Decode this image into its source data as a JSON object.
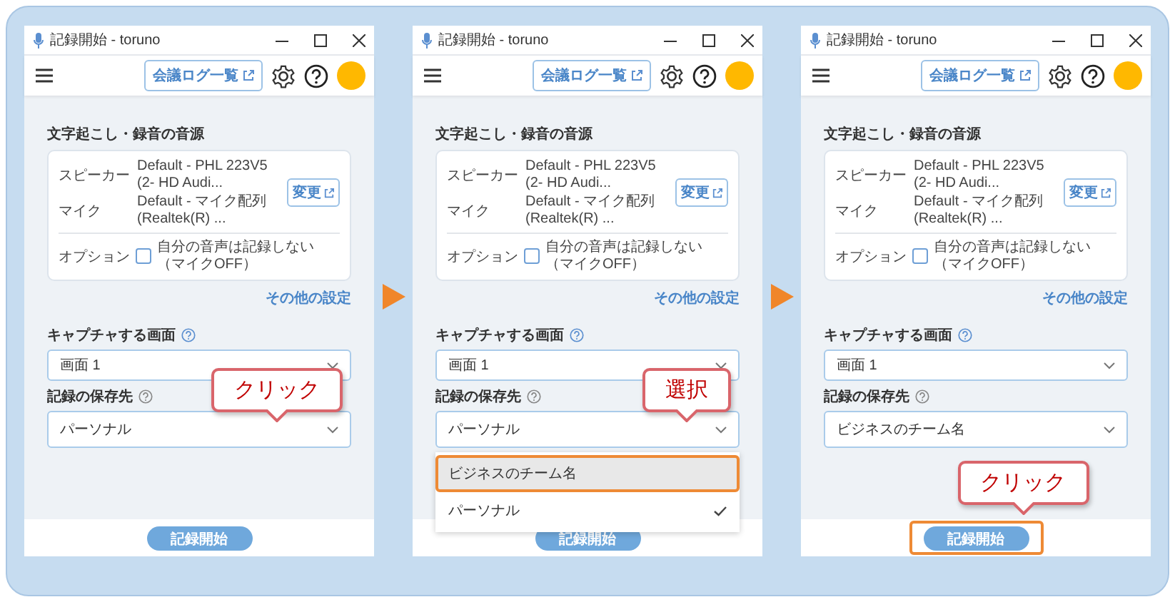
{
  "panels": [
    {
      "window_title": "記録開始 - toruno",
      "log_button": "会議ログ一覧",
      "source_heading": "文字起こし・録音の音源",
      "speaker_label": "スピーカー",
      "speaker_value": "Default - PHL 223V5 (2- HD Audi...",
      "mic_label": "マイク",
      "mic_value": "Default - マイク配列 (Realtek(R) ...",
      "change_button": "変更",
      "option_label": "オプション",
      "option_checkbox": {
        "label": "自分の音声は記録しない（マイクOFF）",
        "checked": false
      },
      "more_settings": "その他の設定",
      "capture_label": "キャプチャする画面",
      "capture_value": "画面 1",
      "save_label": "記録の保存先",
      "save_value": "パーソナル",
      "save_callout": "クリック",
      "start_button": {
        "label": "記録開始",
        "highlighted": false
      }
    },
    {
      "window_title": "記録開始 - toruno",
      "log_button": "会議ログ一覧",
      "source_heading": "文字起こし・録音の音源",
      "speaker_label": "スピーカー",
      "speaker_value": "Default - PHL 223V5 (2- HD Audi...",
      "mic_label": "マイク",
      "mic_value": "Default - マイク配列 (Realtek(R) ...",
      "change_button": "変更",
      "option_label": "オプション",
      "option_checkbox": {
        "label": "自分の音声は記録しない（マイクOFF）",
        "checked": false
      },
      "more_settings": "その他の設定",
      "capture_label": "キャプチャする画面",
      "capture_value": "画面 1",
      "save_label": "記録の保存先",
      "save_value": "パーソナル",
      "dropdown": [
        {
          "label": "ビジネスのチーム名",
          "selected": false,
          "highlighted": true
        },
        {
          "label": "パーソナル",
          "selected": true,
          "highlighted": false
        }
      ],
      "save_callout": "選択",
      "start_button": {
        "label": "記録開始",
        "highlighted": false
      }
    },
    {
      "window_title": "記録開始 - toruno",
      "log_button": "会議ログ一覧",
      "source_heading": "文字起こし・録音の音源",
      "speaker_label": "スピーカー",
      "speaker_value": "Default - PHL 223V5 (2- HD Audi...",
      "mic_label": "マイク",
      "mic_value": "Default - マイク配列 (Realtek(R) ...",
      "change_button": "変更",
      "option_label": "オプション",
      "option_checkbox": {
        "label": "自分の音声は記録しない（マイクOFF）",
        "checked": false
      },
      "more_settings": "その他の設定",
      "capture_label": "キャプチャする画面",
      "capture_value": "画面 1",
      "save_label": "記録の保存先",
      "save_value": "ビジネスのチーム名",
      "start_button": {
        "label": "記録開始",
        "highlighted": true,
        "callout": "クリック"
      }
    }
  ]
}
